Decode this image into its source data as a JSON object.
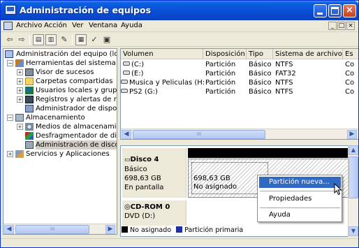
{
  "window": {
    "title": "Administración de equipos",
    "controls": {
      "minimize": "_",
      "maximize": "□",
      "close": "×"
    }
  },
  "menubar": {
    "items": [
      "Archivo",
      "Acción",
      "Ver",
      "Ventana",
      "Ayuda"
    ],
    "mdi_controls": [
      "_",
      "□",
      "×"
    ]
  },
  "toolbar": {
    "buttons": [
      "back-arrow-icon",
      "forward-arrow-icon",
      "up-folder-icon",
      "show-tree-icon",
      "help-icon",
      "properties-icon",
      "settings-icon",
      "disk-icon"
    ]
  },
  "tree": {
    "items": [
      {
        "label": "Administración del equipo (loca",
        "level": 0,
        "expander": "",
        "icon": "computer-icon"
      },
      {
        "label": "Herramientas del sistema",
        "level": 1,
        "expander": "−",
        "icon": "tools-icon"
      },
      {
        "label": "Visor de sucesos",
        "level": 2,
        "expander": "+",
        "icon": "event-viewer-icon"
      },
      {
        "label": "Carpetas compartidas",
        "level": 2,
        "expander": "+",
        "icon": "shared-folder-icon"
      },
      {
        "label": "Usuarios locales y grupc",
        "level": 2,
        "expander": "+",
        "icon": "users-icon"
      },
      {
        "label": "Registros y alertas de re",
        "level": 2,
        "expander": "+",
        "icon": "performance-icon"
      },
      {
        "label": "Administrador de dispos",
        "level": 2,
        "expander": "",
        "icon": "device-manager-icon"
      },
      {
        "label": "Almacenamiento",
        "level": 1,
        "expander": "−",
        "icon": "storage-icon"
      },
      {
        "label": "Medios de almacenamie",
        "level": 2,
        "expander": "+",
        "icon": "removable-storage-icon"
      },
      {
        "label": "Desfragmentador de dis",
        "level": 2,
        "expander": "",
        "icon": "defrag-icon"
      },
      {
        "label": "Administración de discos",
        "level": 2,
        "expander": "",
        "icon": "disk-management-icon",
        "selected": true
      },
      {
        "label": "Servicios y Aplicaciones",
        "level": 1,
        "expander": "+",
        "icon": "services-icon"
      }
    ]
  },
  "volumes": {
    "columns": [
      "Volumen",
      "Disposición",
      "Tipo",
      "Sistema de archivos",
      "Es"
    ],
    "rows": [
      [
        "(C:)",
        "Partición",
        "Básico",
        "NTFS",
        "Co"
      ],
      [
        "(E:)",
        "Partición",
        "Básico",
        "FAT32",
        "Co"
      ],
      [
        "Musica y Peliculas (H:)",
        "Partición",
        "Básico",
        "NTFS",
        "Co"
      ],
      [
        "PS2 (G:)",
        "Partición",
        "Básico",
        "NTFS",
        "Co"
      ]
    ]
  },
  "disks": [
    {
      "name": "Disco 4",
      "type": "Básico",
      "size": "698,63 GB",
      "status": "En pantalla",
      "partition": {
        "size": "698,63 GB",
        "status": "No asignado"
      }
    },
    {
      "name": "CD-ROM 0",
      "type": "DVD (D:)"
    }
  ],
  "legend": [
    {
      "label": "No asignado",
      "color": "#000000"
    },
    {
      "label": "Partición primaria",
      "color": "#1e2f9e"
    }
  ],
  "context_menu": {
    "items": [
      "Partición nueva...",
      "Propiedades",
      "Ayuda"
    ],
    "highlighted": 0
  },
  "colors": {
    "titlebar": "#0a4fd6",
    "selection": "#316ac5",
    "primary_partition": "#1e2f9e"
  }
}
